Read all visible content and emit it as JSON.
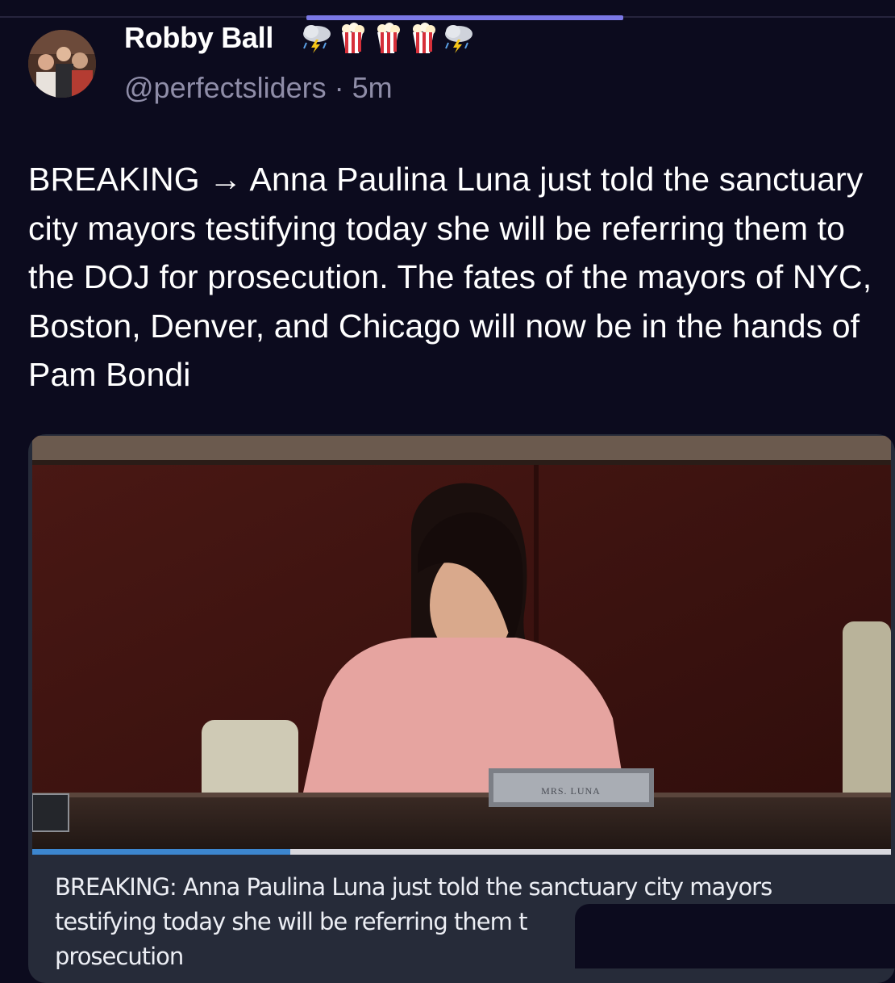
{
  "post": {
    "author": {
      "name": "Robby Ball",
      "name_emojis": [
        "cloud-lightning-rain-icon",
        "popcorn-icon",
        "popcorn-icon",
        "popcorn-icon",
        "cloud-lightning-rain-icon"
      ],
      "handle": "@perfectsliders",
      "separator": " · ",
      "time": "5m"
    },
    "text": "BREAKING → Anna Paulina Luna just told the sanctuary city mayors testifying today she will be referring them to the DOJ for prosecution. The fates of the mayors of NYC, Boston, Denver, and Chicago will now be in the hands of Pam Bondi",
    "media": {
      "type": "video",
      "nameplate": "MRS. LUNA",
      "progress": 0.3,
      "caption": "BREAKING: Anna Paulina Luna just told the sanctuary city mayors testifying today she will be referring them t",
      "caption_cut_line": "prosecution"
    }
  },
  "colors": {
    "background": "#0c0b1e",
    "accent": "#7b78e6",
    "muted_text": "#8f8da8",
    "progress": "#3c86cf"
  }
}
